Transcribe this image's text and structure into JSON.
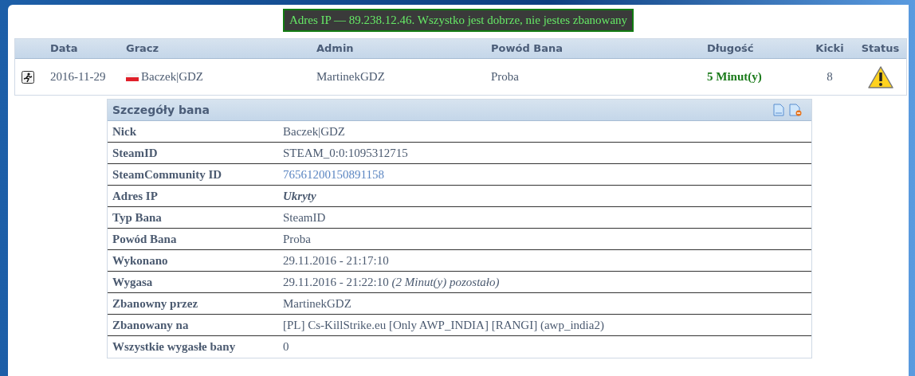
{
  "notice": "Adres IP — 89.238.12.46. Wszystko jest dobrze, nie jestes zbanowany",
  "table": {
    "columns": [
      "Data",
      "Gracz",
      "Admin",
      "Powód Bana",
      "Długość",
      "Kicki",
      "Status"
    ],
    "rows": [
      {
        "date": "2016-11-29",
        "player": "Baczek|GDZ",
        "admin": "MartinekGDZ",
        "reason": "Proba",
        "length": "5 Minut(y)",
        "kicks": "8"
      }
    ]
  },
  "details": {
    "title": "Szczegóły bana",
    "rows": [
      {
        "label": "Nick",
        "value": "Baczek|GDZ",
        "kind": "text"
      },
      {
        "label": "SteamID",
        "value": "STEAM_0:0:1095312715",
        "kind": "text"
      },
      {
        "label": "SteamCommunity ID",
        "value": "76561200150891158",
        "kind": "link"
      },
      {
        "label": "Adres IP",
        "value": "Ukryty",
        "kind": "hidden"
      },
      {
        "label": "Typ Bana",
        "value": "SteamID",
        "kind": "text"
      },
      {
        "label": "Powód Bana",
        "value": "Proba",
        "kind": "text"
      },
      {
        "label": "Wykonano",
        "value": "29.11.2016 - 21:17:10",
        "kind": "text"
      },
      {
        "label": "Wygasa",
        "value": "29.11.2016 - 21:22:10 *(2 Minut(y) pozostało)*",
        "kind": "text"
      },
      {
        "label": "Zbanowny przez",
        "value": "MartinekGDZ",
        "kind": "text"
      },
      {
        "label": "Zbanowany na",
        "value": "[PL] Cs-KillStrike.eu [Only AWP_INDIA] [RANGI] (awp_india2)",
        "kind": "text"
      },
      {
        "label": "Wszystkie wygasłe bany",
        "value": "0",
        "kind": "text"
      }
    ]
  }
}
